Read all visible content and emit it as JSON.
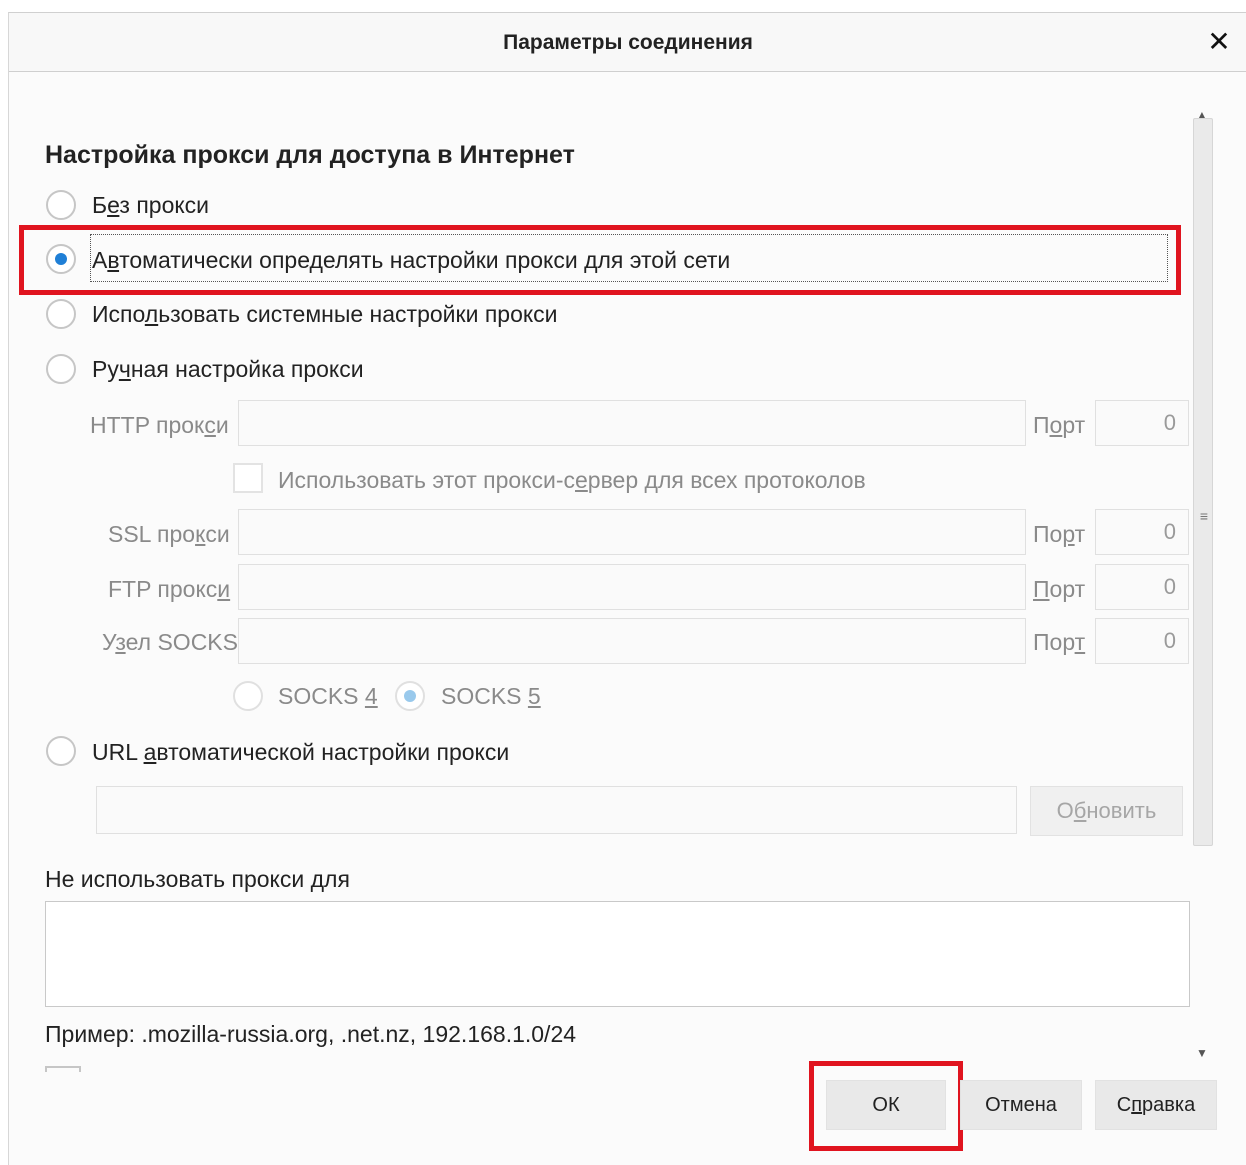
{
  "dialog": {
    "title": "Параметры соединения",
    "close_glyph": "✕"
  },
  "section_heading": "Настройка прокси для доступа в Интернет",
  "proxy_options": [
    {
      "label_pre": "Б",
      "label_u": "е",
      "label_post": "з прокси",
      "selected": false
    },
    {
      "label_pre": "А",
      "label_u": "в",
      "label_post": "томатически определять настройки прокси для этой сети",
      "selected": true
    },
    {
      "label_pre": "Испо",
      "label_u": "л",
      "label_post": "ьзовать системные настройки прокси",
      "selected": false
    },
    {
      "label_pre": "Ру",
      "label_u": "ч",
      "label_post": "ная настройка прокси",
      "selected": false
    },
    {
      "label_pre": "URL ",
      "label_u": "а",
      "label_post": "втоматической настройки прокси",
      "selected": false
    }
  ],
  "manual": {
    "http_label_pre": "HTTP прок",
    "http_label_u": "с",
    "http_label_post": "и",
    "http_port_label_pre": "П",
    "http_port_label_u": "о",
    "http_port_label_post": "рт",
    "http_port_value": "0",
    "share_checkbox_pre": "Использовать этот прокси-с",
    "share_checkbox_u": "е",
    "share_checkbox_post": "рвер для всех протоколов",
    "ssl_label_pre": "SSL про",
    "ssl_label_u": "к",
    "ssl_label_post": "си",
    "ssl_port_label_pre": "По",
    "ssl_port_label_u": "р",
    "ssl_port_label_post": "т",
    "ssl_port_value": "0",
    "ftp_label_pre": "FTP прокс",
    "ftp_label_u": "и",
    "ftp_label_post": "",
    "ftp_port_label_pre": "",
    "ftp_port_label_u": "П",
    "ftp_port_label_post": "орт",
    "ftp_port_value": "0",
    "socks_label_pre": "У",
    "socks_label_u": "з",
    "socks_label_post": "ел SOCKS",
    "socks_port_label_pre": "Пор",
    "socks_port_label_u": "т",
    "socks_port_label_post": "",
    "socks_port_value": "0",
    "socks4_pre": "SOCKS ",
    "socks4_u": "4",
    "socks5_pre": "SOCKS ",
    "socks5_u": "5",
    "socks_version_selected": "SOCKS 5"
  },
  "auto_url": {
    "value": "",
    "reload_pre": "О",
    "reload_u": "б",
    "reload_post": "новить"
  },
  "no_proxy": {
    "label_pre": "Не использовать прокси ",
    "label_u": "д",
    "label_post": "ля",
    "value": "",
    "example": "Пример: .mozilla-russia.org, .net.nz, 192.168.1.0/24"
  },
  "buttons": {
    "ok": "ОК",
    "cancel": "Отмена",
    "help_pre": "С",
    "help_u": "п",
    "help_post": "равка"
  },
  "scrollbar": {
    "up_arrow": "▲",
    "down_arrow": "▼",
    "grip": "≡"
  },
  "colors": {
    "accent": "#1f7fd6",
    "highlight": "#e0141f"
  }
}
